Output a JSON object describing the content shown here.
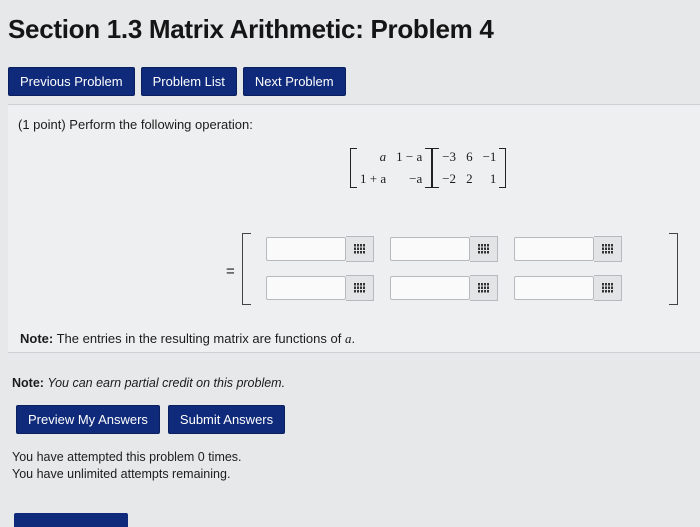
{
  "page": {
    "title": "Section 1.3 Matrix Arithmetic: Problem 4"
  },
  "nav": {
    "previous_label": "Previous Problem",
    "list_label": "Problem List",
    "next_label": "Next Problem"
  },
  "problem": {
    "prompt": "(1 point) Perform the following operation:",
    "left_matrix": [
      [
        "a",
        "1 − a"
      ],
      [
        "1 + a",
        "−a"
      ]
    ],
    "right_matrix": [
      [
        "−3",
        "6",
        "−1"
      ],
      [
        "−2",
        "2",
        "1"
      ]
    ],
    "equals_sign": "=",
    "answer_rows": 2,
    "answer_cols": 3,
    "answer_values": [
      [
        "",
        "",
        ""
      ],
      [
        "",
        "",
        ""
      ]
    ],
    "keypad_icon": "keypad-icon",
    "note_label": "Note:",
    "note_text": "The entries in the resulting matrix are functions of",
    "note_var": "a",
    "note_end": "."
  },
  "footer": {
    "partial_label": "Note:",
    "partial_text": "You can earn partial credit on this problem.",
    "preview_label": "Preview My Answers",
    "submit_label": "Submit Answers",
    "attempted_text": "You have attempted this problem 0 times.",
    "remaining_text": "You have unlimited attempts remaining."
  },
  "colors": {
    "button": "#0f2a7a",
    "background": "#e7e8ea"
  }
}
